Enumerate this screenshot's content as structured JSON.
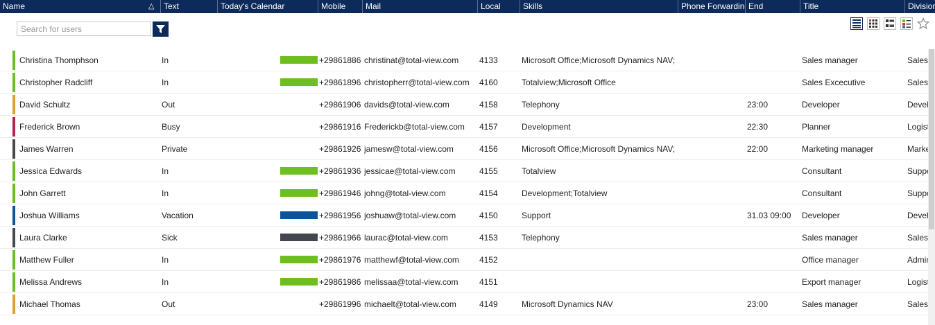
{
  "columns": [
    {
      "label": "Name"
    },
    {
      "label": "Text"
    },
    {
      "label": "Today's Calendar"
    },
    {
      "label": "Mobile"
    },
    {
      "label": "Mail"
    },
    {
      "label": "Local"
    },
    {
      "label": "Skills"
    },
    {
      "label": "Phone Forwarding"
    },
    {
      "label": "End"
    },
    {
      "label": "Title"
    },
    {
      "label": "Division"
    }
  ],
  "search": {
    "placeholder": "Search for users"
  },
  "colors": {
    "header": "#0c2a5a",
    "in": "#6cbf1f",
    "out": "#e0a030",
    "busy": "#b5244c",
    "private": "#44474d",
    "vacation": "#0a5599",
    "sick": "#44474d"
  },
  "icons": [
    "sort-ascending-icon",
    "filter-icon",
    "list-view-icon",
    "grid-view-icon",
    "detail-view-icon",
    "card-view-icon",
    "star-icon"
  ],
  "users": [
    {
      "name": "Christina Thomphson",
      "status": "In",
      "status_color": "#6cbf1f",
      "calendar_color": "#6cbf1f",
      "mobile": "+29861886",
      "mail": "christinat@total-view.com",
      "local": "4133",
      "skills": "Microsoft Office;Microsoft Dynamics NAV;",
      "forwarding": "",
      "end": "",
      "title": "Sales manager",
      "division": "Sales"
    },
    {
      "name": "Christopher Radcliff",
      "status": "In",
      "status_color": "#6cbf1f",
      "calendar_color": "#6cbf1f",
      "mobile": "+29861896",
      "mail": "christopherr@total-view.com",
      "local": "4160",
      "skills": "Totalview;Microsoft Office",
      "forwarding": "",
      "end": "",
      "title": "Sales Excecutive",
      "division": "Sales"
    },
    {
      "name": "David Schultz",
      "status": "Out",
      "status_color": "#e0a030",
      "calendar_color": "",
      "mobile": "+29861906",
      "mail": "davids@total-view.com",
      "local": "4158",
      "skills": "Telephony",
      "forwarding": "",
      "end": "23:00",
      "title": "Developer",
      "division": "Devel"
    },
    {
      "name": "Frederick Brown",
      "status": "Busy",
      "status_color": "#b5244c",
      "calendar_color": "",
      "mobile": "+29861916",
      "mail": "Frederickb@total-view.com",
      "local": "4157",
      "skills": "Development",
      "forwarding": "",
      "end": "22:30",
      "title": "Planner",
      "division": "Logist"
    },
    {
      "name": "James Warren",
      "status": "Private",
      "status_color": "#44474d",
      "calendar_color": "",
      "mobile": "+29861926",
      "mail": "jamesw@total-view.com",
      "local": "4156",
      "skills": "Microsoft Office;Microsoft Dynamics NAV;",
      "forwarding": "",
      "end": "22:00",
      "title": "Marketing manager",
      "division": "Marke"
    },
    {
      "name": "Jessica Edwards",
      "status": "In",
      "status_color": "#6cbf1f",
      "calendar_color": "#6cbf1f",
      "mobile": "+29861936",
      "mail": "jessicae@total-view.com",
      "local": "4155",
      "skills": "Totalview",
      "forwarding": "",
      "end": "",
      "title": "Consultant",
      "division": "Suppo"
    },
    {
      "name": "John Garrett",
      "status": "In",
      "status_color": "#6cbf1f",
      "calendar_color": "#6cbf1f",
      "mobile": "+29861946",
      "mail": "johng@total-view.com",
      "local": "4154",
      "skills": "Development;Totalview",
      "forwarding": "",
      "end": "",
      "title": "Consultant",
      "division": "Suppo"
    },
    {
      "name": "Joshua Williams",
      "status": "Vacation",
      "status_color": "#0a5599",
      "calendar_color": "#0a5599",
      "mobile": "+29861956",
      "mail": "joshuaw@total-view.com",
      "local": "4150",
      "skills": "Support",
      "forwarding": "",
      "end": "31.03 09:00",
      "title": "Developer",
      "division": "Develo"
    },
    {
      "name": "Laura Clarke",
      "status": "Sick",
      "status_color": "#44474d",
      "calendar_color": "#44474d",
      "mobile": "+29861966",
      "mail": "laurac@total-view.com",
      "local": "4153",
      "skills": "Telephony",
      "forwarding": "",
      "end": "",
      "title": "Sales manager",
      "division": "Sales"
    },
    {
      "name": "Matthew Fuller",
      "status": "In",
      "status_color": "#6cbf1f",
      "calendar_color": "#6cbf1f",
      "mobile": "+29861976",
      "mail": "matthewf@total-view.com",
      "local": "4152",
      "skills": "",
      "forwarding": "",
      "end": "",
      "title": "Office manager",
      "division": "Adminis"
    },
    {
      "name": "Melissa Andrews",
      "status": "In",
      "status_color": "#6cbf1f",
      "calendar_color": "#6cbf1f",
      "mobile": "+29861986",
      "mail": "melissaa@total-view.com",
      "local": "4151",
      "skills": "",
      "forwarding": "",
      "end": "",
      "title": "Export manager",
      "division": "Logistic"
    },
    {
      "name": "Michael Thomas",
      "status": "Out",
      "status_color": "#e0a030",
      "calendar_color": "",
      "mobile": "+29861996",
      "mail": "michaelt@total-view.com",
      "local": "4149",
      "skills": "Microsoft Dynamics NAV",
      "forwarding": "",
      "end": "23:00",
      "title": "Sales manager",
      "division": "Sales"
    }
  ]
}
